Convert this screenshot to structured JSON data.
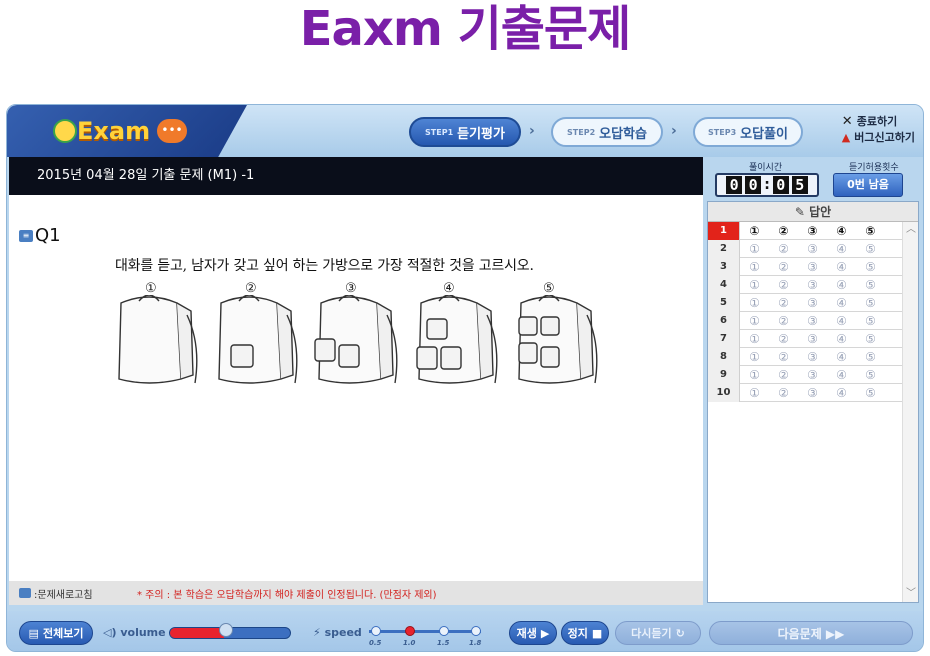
{
  "page_title": "Eaxm 기출문제",
  "app": {
    "logo_text": "Exam",
    "logo_bubble": "•••",
    "steps": [
      {
        "tag": "STEP1",
        "label": "듣기평가",
        "active": true
      },
      {
        "tag": "STEP2",
        "label": "오답학습",
        "active": false
      },
      {
        "tag": "STEP3",
        "label": "오답풀이",
        "active": false
      }
    ],
    "step_arrow": "›",
    "top_links": {
      "exit_icon": "✕",
      "exit_label": "종료하기",
      "bug_icon": "bug-icon",
      "bug_label": "버그신고하기"
    }
  },
  "question_header": "2015년 04월 28일 기출 문제 (M1) -1",
  "question": {
    "number": "Q1",
    "text": "대화를 듣고, 남자가 갖고 싶어 하는 가방으로 가장 적절한 것을 고르시오.",
    "options": [
      "①",
      "②",
      "③",
      "④",
      "⑤"
    ]
  },
  "status": {
    "refresh_label": ":문제새로고침",
    "notice": "* 주의 : 본 학습은 오답학습까지 해야 제출이 인정됩니다. (만점자 제외)"
  },
  "timer": {
    "label": "풀이시간",
    "digits": [
      "0",
      "0",
      "0",
      "5"
    ],
    "colon": ":"
  },
  "remaining": {
    "label": "듣기허용횟수",
    "value": "0번 남음"
  },
  "answer_panel": {
    "title": "답안",
    "choices": [
      "①",
      "②",
      "③",
      "④",
      "⑤"
    ],
    "rows": [
      "1",
      "2",
      "3",
      "4",
      "5",
      "6",
      "7",
      "8",
      "9",
      "10"
    ],
    "selected_row": 1,
    "scroll_up": "︿",
    "scroll_down": "﹀"
  },
  "controls": {
    "full_view": "전체보기",
    "volume_label": "volume",
    "volume_level": 0.45,
    "speed_label": "speed",
    "speed_ticks": [
      "0.5",
      "1.0",
      "1.5",
      "1.8"
    ],
    "speed_selected": "1.0",
    "play": "재생",
    "stop": "정지",
    "relisten": "다시듣기",
    "next": "다음문제 ▶▶"
  },
  "colors": {
    "title": "#7a1fa8",
    "accent": "#2558b0",
    "selected_row": "#e2231a",
    "notice": "#d3211e"
  }
}
